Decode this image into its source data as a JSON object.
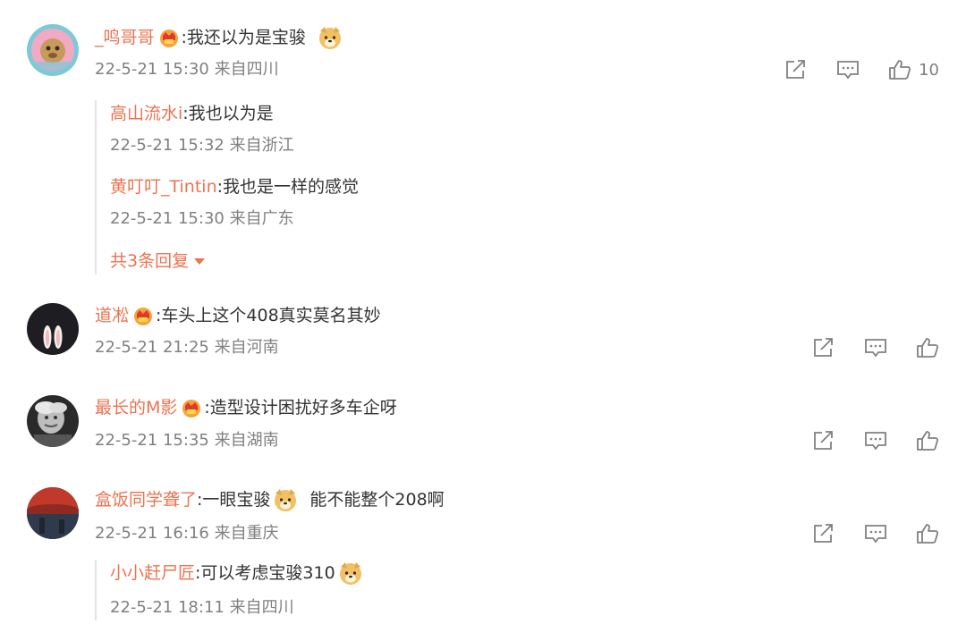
{
  "comments": [
    {
      "username": "_鸣哥哥",
      "text": ":我还以为是宝骏",
      "meta": "22-5-21 15:30 来自四川",
      "likes": "10",
      "replies": [
        {
          "username": "高山流水i",
          "text": ":我也以为是",
          "meta": "22-5-21 15:32 来自浙江"
        },
        {
          "username": "黄叮叮_Tintin",
          "text": ":我也是一样的感觉",
          "meta": "22-5-21 15:30 来自广东"
        }
      ],
      "more_replies": "共3条回复"
    },
    {
      "username": "道凇",
      "text": ":车头上这个408真实莫名其妙",
      "meta": "22-5-21 21:25 来自河南"
    },
    {
      "username": "最长的M影",
      "text": ":造型设计困扰好多车企呀",
      "meta": "22-5-21 15:35 来自湖南"
    },
    {
      "username": "盒饭同学聋了",
      "text": ":一眼宝骏",
      "text_after": "能不能整个208啊",
      "meta": "22-5-21 16:16 来自重庆",
      "replies": [
        {
          "username": "小小赶尸匠",
          "text": ":可以考虑宝骏310",
          "meta": "22-5-21 18:11 来自四川"
        }
      ]
    }
  ],
  "colors": {
    "accent": "#eb7350",
    "text": "#333333",
    "meta": "#808080"
  },
  "icons": [
    "share-icon",
    "comment-icon",
    "like-icon",
    "vip-crown-badge",
    "doge-emoji"
  ]
}
